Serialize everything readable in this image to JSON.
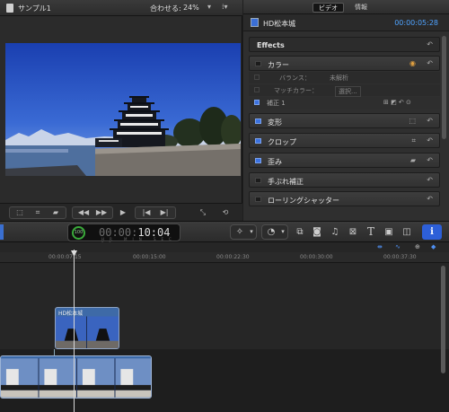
{
  "viewer": {
    "project_title": "サンプル1",
    "fit_label": "合わせる:",
    "zoom_value": "24%"
  },
  "inspector": {
    "tabs": [
      "ビデオ",
      "情報"
    ],
    "active_tab": "ビデオ",
    "clip_name": "HD松本城",
    "timecode": "00:00:05:28",
    "sections": {
      "effects": "Effects",
      "color": "カラー",
      "balance_label": "バランス：",
      "balance_value": "未解析",
      "match_color_label": "マッチカラー：",
      "match_color_value": "選択...",
      "correction": "補正 1",
      "transform": "変形",
      "crop": "クロップ",
      "distort": "歪み",
      "stabilization": "手ぶれ補正",
      "rolling_shutter": "ローリングシャッター"
    }
  },
  "timecode_display": {
    "dim_digits": "00:00:",
    "bright_digits": "10:04",
    "ring_label": "100",
    "units": "HR MIN SEC FR"
  },
  "ruler": {
    "ticks": [
      "00:00:07:15",
      "00:00:15:00",
      "00:00:22:30",
      "00:00:30:00",
      "00:00:37:30"
    ]
  },
  "timeline": {
    "connected_clip_name": "HD松本城"
  },
  "colors": {
    "accent": "#2d5fd8",
    "timecode_blue": "#4fa3ff",
    "clip_blue": "#3e6aa7"
  },
  "icons": [
    "document-icon",
    "camera-icon",
    "film-icon",
    "reset-icon",
    "color-board-icon",
    "play-icon",
    "info-icon",
    "magic-wand-icon",
    "speed-icon",
    "photo-icon",
    "music-icon",
    "title-icon",
    "generator-icon",
    "theme-icon",
    "transition-icon"
  ]
}
